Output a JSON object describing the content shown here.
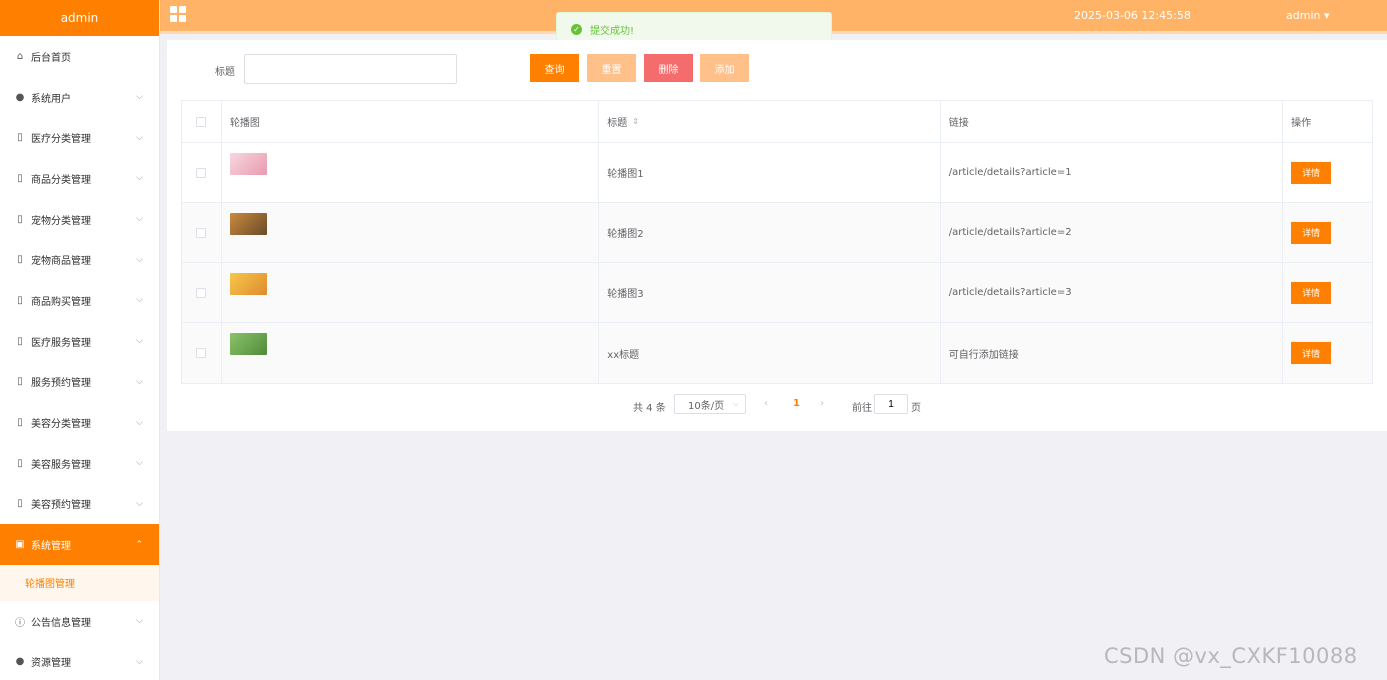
{
  "sidebar": {
    "brand": "admin",
    "items": [
      {
        "label": "后台首页",
        "icon": "home-icon",
        "glyph": "⌂",
        "expandable": false
      },
      {
        "label": "系统用户",
        "icon": "user-icon",
        "glyph": "●",
        "expandable": true
      },
      {
        "label": "医疗分类管理",
        "icon": "folder-icon",
        "glyph": "▯",
        "expandable": true
      },
      {
        "label": "商品分类管理",
        "icon": "folder-icon",
        "glyph": "▯",
        "expandable": true
      },
      {
        "label": "宠物分类管理",
        "icon": "folder-icon",
        "glyph": "▯",
        "expandable": true
      },
      {
        "label": "宠物商品管理",
        "icon": "folder-icon",
        "glyph": "▯",
        "expandable": true
      },
      {
        "label": "商品购买管理",
        "icon": "folder-icon",
        "glyph": "▯",
        "expandable": true
      },
      {
        "label": "医疗服务管理",
        "icon": "folder-icon",
        "glyph": "▯",
        "expandable": true
      },
      {
        "label": "服务预约管理",
        "icon": "folder-icon",
        "glyph": "▯",
        "expandable": true
      },
      {
        "label": "美容分类管理",
        "icon": "folder-icon",
        "glyph": "▯",
        "expandable": true
      },
      {
        "label": "美容服务管理",
        "icon": "folder-icon",
        "glyph": "▯",
        "expandable": true
      },
      {
        "label": "美容预约管理",
        "icon": "folder-icon",
        "glyph": "▯",
        "expandable": true
      }
    ],
    "active_item": {
      "label": "系统管理",
      "icon": "image-icon",
      "glyph": "▣"
    },
    "active_submenu": "轮播图管理",
    "bottom_items": [
      {
        "label": "公告信息管理",
        "icon": "info-icon",
        "glyph": "ⓘ"
      },
      {
        "label": "资源管理",
        "icon": "location-icon",
        "glyph": "●"
      }
    ]
  },
  "topbar": {
    "datetime": "2025-03-06 12:45:58",
    "user": "admin"
  },
  "toast": {
    "message": "提交成功!"
  },
  "search": {
    "label": "标题",
    "value": ""
  },
  "toolbar": {
    "query": "查询",
    "reset": "重置",
    "delete": "删除",
    "add": "添加"
  },
  "table": {
    "headers": {
      "image": "轮播图",
      "title": "标题",
      "link": "链接",
      "op": "操作"
    },
    "rows": [
      {
        "title": "轮播图1",
        "link": "/article/details?article=1",
        "action": "详情",
        "thumb_colors": [
          "#f7d7e0",
          "#e89ab0"
        ]
      },
      {
        "title": "轮播图2",
        "link": "/article/details?article=2",
        "action": "详情",
        "thumb_colors": [
          "#c98a3e",
          "#6b4a2a"
        ]
      },
      {
        "title": "轮播图3",
        "link": "/article/details?article=3",
        "action": "详情",
        "thumb_colors": [
          "#f6c84a",
          "#e08a2f"
        ]
      },
      {
        "title": "xx标题",
        "link": "可自行添加链接",
        "action": "详情",
        "thumb_colors": [
          "#8cc46a",
          "#4f8a3a"
        ]
      }
    ]
  },
  "pagination": {
    "total": "共 4 条",
    "page_size": "10条/页",
    "current_page": "1",
    "goto_label": "前往",
    "goto_value": "1",
    "page_suffix": "页"
  },
  "watermark": "CSDN @vx_CXKF10088",
  "colors": {
    "accent": "#ff8000",
    "topbar": "#ffb366",
    "danger": "#f56c6c",
    "success": "#67c23a"
  }
}
